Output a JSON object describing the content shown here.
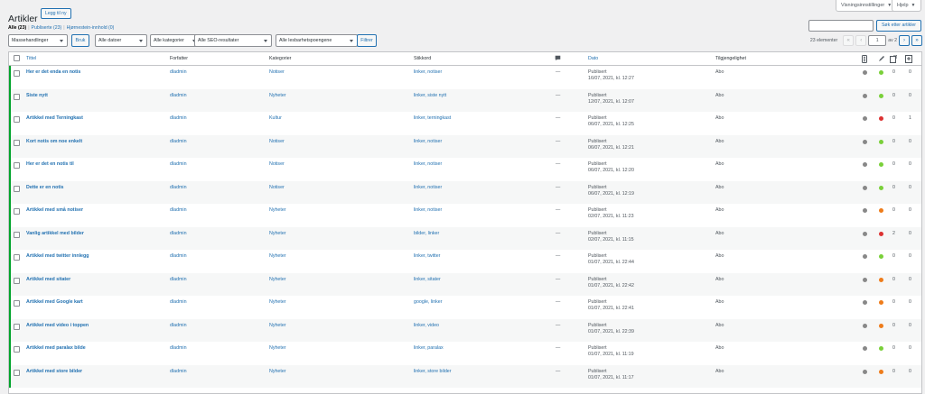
{
  "header": {
    "screen_options": "Visningsinnstillinger",
    "help": "Hjelp",
    "title": "Artikler",
    "add_new": "Legg til ny"
  },
  "views": {
    "all": "Alle (23)",
    "published": "Publiserte (23)",
    "cornerstone": "Hjørnestein-innhold (0)"
  },
  "search": {
    "value": "",
    "button": "Søk etter artikler"
  },
  "filters": {
    "bulk": "Massehandlinger",
    "apply": "Bruk",
    "dates": "Alle datoer",
    "categories": "Alle kategorier",
    "seo": "Alle SEO-resultater",
    "readability": "Alle lesbarhetspoengene",
    "filter_button": "Filtrer"
  },
  "pagination": {
    "count": "23 elementer",
    "first": "«",
    "prev": "‹",
    "current": "1",
    "of": "av 2",
    "next": "›",
    "last": "»"
  },
  "columns": {
    "title": "Tittel",
    "author": "Forfatter",
    "categories": "Kategorier",
    "tags": "Stikkord",
    "date": "Dato",
    "accessibility": "Tilgjengelighet"
  },
  "colors": {
    "green": "#7ad03a",
    "red": "#dc3232",
    "orange": "#ee7c1b",
    "gray": "#888888"
  },
  "rows": [
    {
      "title": "Her er det enda en notis",
      "author": "dladmin",
      "category": "Notiser",
      "tags": "linker, notiser",
      "comments": "—",
      "status": "Publisert",
      "date": "16/07, 2021, kl. 12:27",
      "access": "Abo",
      "seo": "gray",
      "read": "green",
      "links_out": "0",
      "links_in": "0"
    },
    {
      "title": "Siste nytt",
      "author": "dladmin",
      "category": "Nyheter",
      "tags": "linker, siste nytt",
      "comments": "—",
      "status": "Publisert",
      "date": "12/07, 2021, kl. 12:07",
      "access": "Abo",
      "seo": "gray",
      "read": "green",
      "links_out": "0",
      "links_in": "0"
    },
    {
      "title": "Artikkel med Terningkast",
      "author": "dladmin",
      "category": "Kultur",
      "tags": "linker, terningkast",
      "comments": "—",
      "status": "Publisert",
      "date": "06/07, 2021, kl. 12:25",
      "access": "Abo",
      "seo": "gray",
      "read": "red",
      "links_out": "0",
      "links_in": "1"
    },
    {
      "title": "Kort notis om noe enkelt",
      "author": "dladmin",
      "category": "Notiser",
      "tags": "linker, notiser",
      "comments": "—",
      "status": "Publisert",
      "date": "06/07, 2021, kl. 12:21",
      "access": "Abo",
      "seo": "gray",
      "read": "green",
      "links_out": "0",
      "links_in": "0"
    },
    {
      "title": "Her er det en notis til",
      "author": "dladmin",
      "category": "Notiser",
      "tags": "linker, notiser",
      "comments": "—",
      "status": "Publisert",
      "date": "06/07, 2021, kl. 12:20",
      "access": "Abo",
      "seo": "gray",
      "read": "green",
      "links_out": "0",
      "links_in": "0"
    },
    {
      "title": "Dette er en notis",
      "author": "dladmin",
      "category": "Notiser",
      "tags": "linker, notiser",
      "comments": "—",
      "status": "Publisert",
      "date": "06/07, 2021, kl. 12:19",
      "access": "Abo",
      "seo": "gray",
      "read": "green",
      "links_out": "0",
      "links_in": "0"
    },
    {
      "title": "Artikkel med små notiser",
      "author": "dladmin",
      "category": "Nyheter",
      "tags": "linker, notiser",
      "comments": "—",
      "status": "Publisert",
      "date": "02/07, 2021, kl. 11:23",
      "access": "Abo",
      "seo": "gray",
      "read": "orange",
      "links_out": "0",
      "links_in": "0"
    },
    {
      "title": "Vanlig artikkel med bilder",
      "author": "dladmin",
      "category": "Nyheter",
      "tags": "bilder, linker",
      "comments": "—",
      "status": "Publisert",
      "date": "02/07, 2021, kl. 11:15",
      "access": "Abo",
      "seo": "gray",
      "read": "red",
      "links_out": "2",
      "links_in": "0"
    },
    {
      "title": "Artikkel med twitter innlegg",
      "author": "dladmin",
      "category": "Nyheter",
      "tags": "linker, twitter",
      "comments": "—",
      "status": "Publisert",
      "date": "01/07, 2021, kl. 22:44",
      "access": "Abo",
      "seo": "gray",
      "read": "green",
      "links_out": "0",
      "links_in": "0"
    },
    {
      "title": "Artikkel med sitater",
      "author": "dladmin",
      "category": "Nyheter",
      "tags": "linker, sitater",
      "comments": "—",
      "status": "Publisert",
      "date": "01/07, 2021, kl. 22:42",
      "access": "Abo",
      "seo": "gray",
      "read": "orange",
      "links_out": "0",
      "links_in": "0"
    },
    {
      "title": "Artikkel med Google kart",
      "author": "dladmin",
      "category": "Nyheter",
      "tags": "google, linker",
      "comments": "—",
      "status": "Publisert",
      "date": "01/07, 2021, kl. 22:41",
      "access": "Abo",
      "seo": "gray",
      "read": "orange",
      "links_out": "0",
      "links_in": "0"
    },
    {
      "title": "Artikkel med video i toppen",
      "author": "dladmin",
      "category": "Nyheter",
      "tags": "linker, video",
      "comments": "—",
      "status": "Publisert",
      "date": "01/07, 2021, kl. 22:39",
      "access": "Abo",
      "seo": "gray",
      "read": "orange",
      "links_out": "0",
      "links_in": "0"
    },
    {
      "title": "Artikkel med paralax bilde",
      "author": "dladmin",
      "category": "Nyheter",
      "tags": "linker, paralax",
      "comments": "—",
      "status": "Publisert",
      "date": "01/07, 2021, kl. 11:19",
      "access": "Abo",
      "seo": "gray",
      "read": "green",
      "links_out": "0",
      "links_in": "0"
    },
    {
      "title": "Artikkel med store bilder",
      "author": "dladmin",
      "category": "Nyheter",
      "tags": "linker, store bilder",
      "comments": "—",
      "status": "Publisert",
      "date": "01/07, 2021, kl. 11:17",
      "access": "Abo",
      "seo": "gray",
      "read": "orange",
      "links_out": "0",
      "links_in": "0"
    }
  ]
}
